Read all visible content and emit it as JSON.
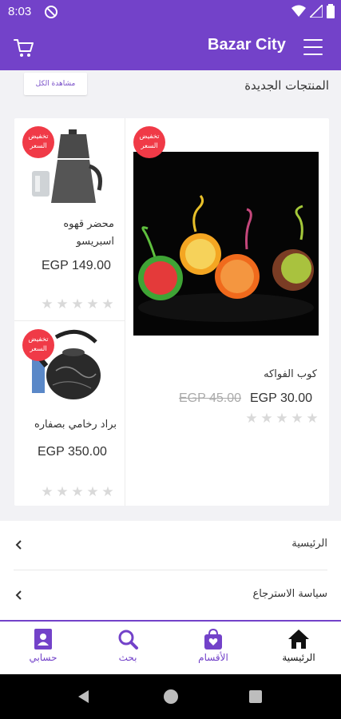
{
  "status": {
    "time": "8:03"
  },
  "app_bar": {
    "title": "Bazar City"
  },
  "section": {
    "title": "المنتجات الجديدة",
    "view_all": "مشاهدة الكل"
  },
  "products": [
    {
      "name": "كوب الفواكه",
      "price": "EGP 30.00",
      "old_price": "EGP 45.00",
      "badge": "تخفيض السعر",
      "rating": 0
    },
    {
      "name": "محضر قهوه اسبريسو",
      "price": "EGP 149.00",
      "badge": "تخفيض السعر",
      "rating": 0
    },
    {
      "name": "براد رخامي بصفاره",
      "price": "EGP 350.00",
      "badge": "تخفيض السعر",
      "rating": 0
    }
  ],
  "links": [
    {
      "label": "الرئيسية"
    },
    {
      "label": "سياسة الاسترجاع"
    }
  ],
  "bottom_nav": [
    {
      "label": "الرئيسية",
      "icon": "home-icon",
      "active": true
    },
    {
      "label": "الأقسام",
      "icon": "shopping-bag-icon"
    },
    {
      "label": "بحث",
      "icon": "search-icon"
    },
    {
      "label": "حسابي",
      "icon": "account-icon"
    }
  ],
  "colors": {
    "primary": "#7342c9",
    "badge": "#f03a47"
  }
}
